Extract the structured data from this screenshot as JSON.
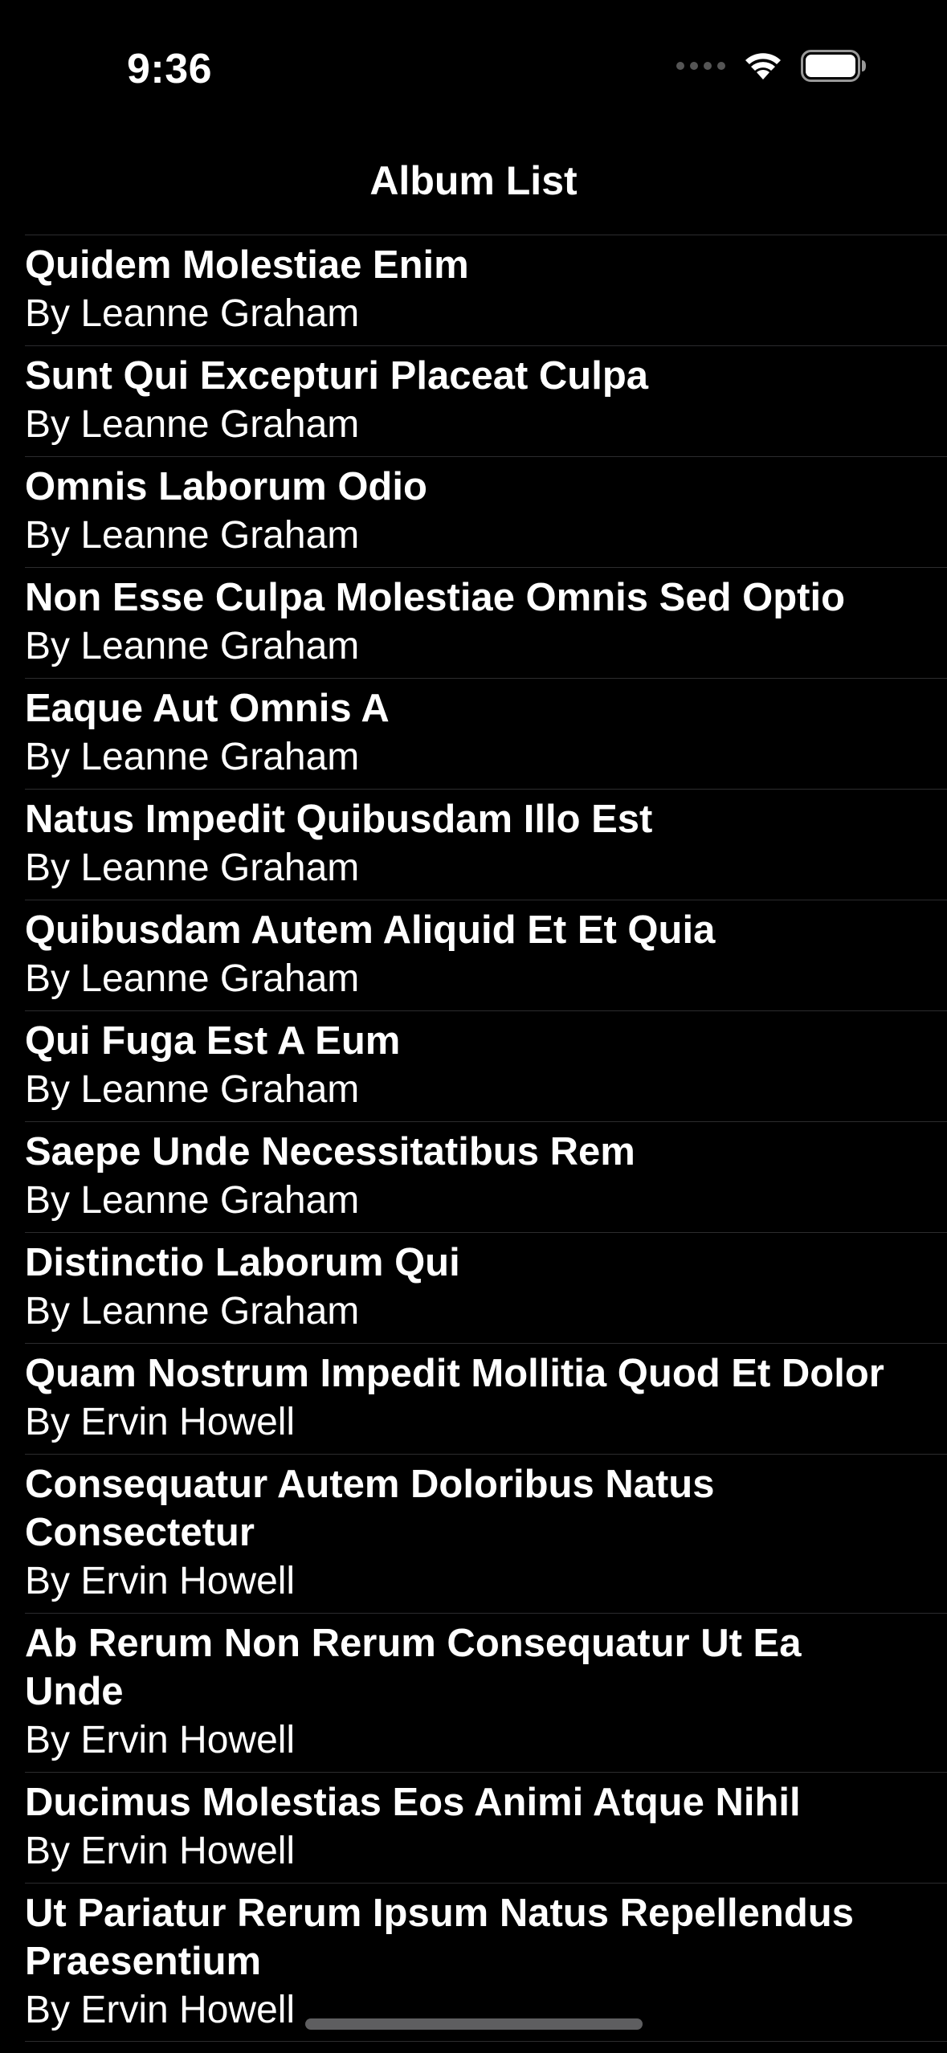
{
  "status_bar": {
    "time": "9:36",
    "icons": [
      "cellular-dots-icon",
      "wifi-icon",
      "battery-icon"
    ]
  },
  "nav": {
    "title": "Album List"
  },
  "albums": [
    {
      "title": "Quidem Molestiae Enim",
      "author": "By Leanne Graham"
    },
    {
      "title": "Sunt Qui Excepturi Placeat Culpa",
      "author": "By Leanne Graham"
    },
    {
      "title": "Omnis Laborum Odio",
      "author": "By Leanne Graham"
    },
    {
      "title": "Non Esse Culpa Molestiae Omnis Sed Optio",
      "author": "By Leanne Graham"
    },
    {
      "title": "Eaque Aut Omnis A",
      "author": "By Leanne Graham"
    },
    {
      "title": "Natus Impedit Quibusdam Illo Est",
      "author": "By Leanne Graham"
    },
    {
      "title": "Quibusdam Autem Aliquid Et Et Quia",
      "author": "By Leanne Graham"
    },
    {
      "title": "Qui Fuga Est A Eum",
      "author": "By Leanne Graham"
    },
    {
      "title": "Saepe Unde Necessitatibus Rem",
      "author": "By Leanne Graham"
    },
    {
      "title": "Distinctio Laborum Qui",
      "author": "By Leanne Graham"
    },
    {
      "title": "Quam Nostrum Impedit Mollitia Quod Et Dolor",
      "author": "By Ervin Howell"
    },
    {
      "title": "Consequatur Autem Doloribus Natus Consectetur",
      "author": "By Ervin Howell"
    },
    {
      "title": "Ab Rerum Non Rerum Consequatur Ut Ea Unde",
      "author": "By Ervin Howell"
    },
    {
      "title": "Ducimus Molestias Eos Animi Atque Nihil",
      "author": "By Ervin Howell"
    },
    {
      "title": "Ut Pariatur Rerum Ipsum Natus Repellendus Praesentium",
      "author": "By Ervin Howell"
    }
  ],
  "colors": {
    "background": "#000000",
    "text": "#ffffff",
    "separator": "#2c2c2e"
  }
}
